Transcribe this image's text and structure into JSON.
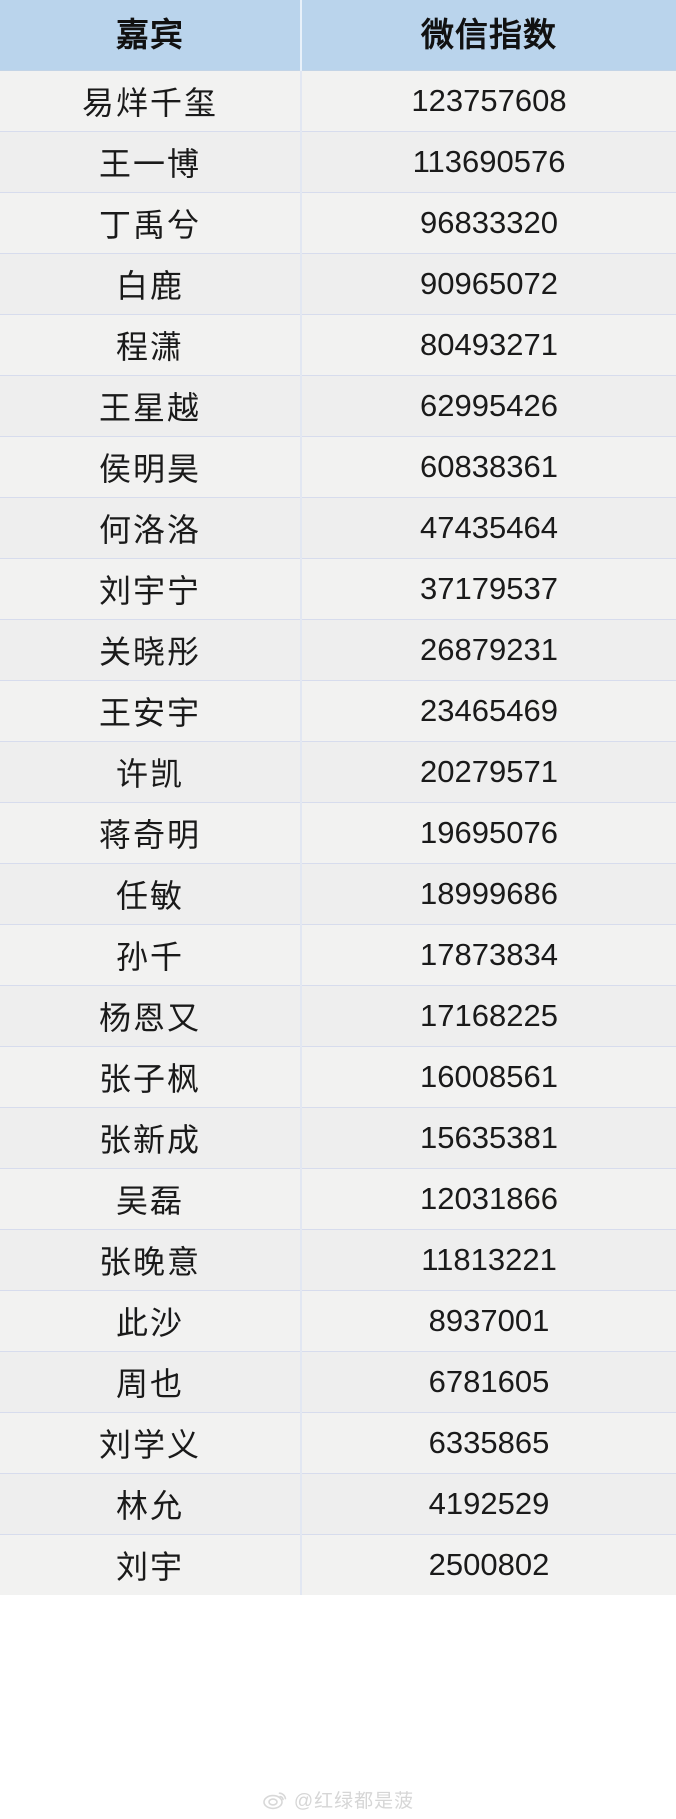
{
  "table": {
    "columns": [
      {
        "key": "guest",
        "label": "嘉宾"
      },
      {
        "key": "index",
        "label": "微信指数"
      }
    ],
    "rows": [
      {
        "guest": "易烊千玺",
        "index": "123757608"
      },
      {
        "guest": "王一博",
        "index": "113690576"
      },
      {
        "guest": "丁禹兮",
        "index": "96833320"
      },
      {
        "guest": "白鹿",
        "index": "90965072"
      },
      {
        "guest": "程潇",
        "index": "80493271"
      },
      {
        "guest": "王星越",
        "index": "62995426"
      },
      {
        "guest": "侯明昊",
        "index": "60838361"
      },
      {
        "guest": "何洛洛",
        "index": "47435464"
      },
      {
        "guest": "刘宇宁",
        "index": "37179537"
      },
      {
        "guest": "关晓彤",
        "index": "26879231"
      },
      {
        "guest": "王安宇",
        "index": "23465469"
      },
      {
        "guest": "许凯",
        "index": "20279571"
      },
      {
        "guest": "蒋奇明",
        "index": "19695076"
      },
      {
        "guest": "任敏",
        "index": "18999686"
      },
      {
        "guest": "孙千",
        "index": "17873834"
      },
      {
        "guest": "杨恩又",
        "index": "17168225"
      },
      {
        "guest": "张子枫",
        "index": "16008561"
      },
      {
        "guest": "张新成",
        "index": "15635381"
      },
      {
        "guest": "吴磊",
        "index": "12031866"
      },
      {
        "guest": "张晚意",
        "index": "11813221"
      },
      {
        "guest": "此沙",
        "index": "8937001"
      },
      {
        "guest": "周也",
        "index": "6781605"
      },
      {
        "guest": "刘学义",
        "index": "6335865"
      },
      {
        "guest": "林允",
        "index": "4192529"
      },
      {
        "guest": "刘宇",
        "index": "2500802"
      }
    ]
  },
  "watermark": {
    "handle": "@红绿都是菠",
    "logo_name": "weibo-eye-icon"
  },
  "colors": {
    "header_background": "#bad4ec",
    "row_background": "#f1f1f0",
    "row_border": "#d7dced",
    "text": "#1a1a1a",
    "watermark_text": "#b5b5b5"
  },
  "chart_data": {
    "type": "table",
    "title": "嘉宾微信指数",
    "columns": [
      "嘉宾",
      "微信指数"
    ],
    "categories": [
      "易烊千玺",
      "王一博",
      "丁禹兮",
      "白鹿",
      "程潇",
      "王星越",
      "侯明昊",
      "何洛洛",
      "刘宇宁",
      "关晓彤",
      "王安宇",
      "许凯",
      "蒋奇明",
      "任敏",
      "孙千",
      "杨恩又",
      "张子枫",
      "张新成",
      "吴磊",
      "张晚意",
      "此沙",
      "周也",
      "刘学义",
      "林允",
      "刘宇"
    ],
    "values": [
      123757608,
      113690576,
      96833320,
      90965072,
      80493271,
      62995426,
      60838361,
      47435464,
      37179537,
      26879231,
      23465469,
      20279571,
      19695076,
      18999686,
      17873834,
      17168225,
      16008561,
      15635381,
      12031866,
      11813221,
      8937001,
      6781605,
      6335865,
      4192529,
      2500802
    ],
    "xlabel": "嘉宾",
    "ylabel": "微信指数",
    "ylim": [
      0,
      123757608
    ]
  }
}
